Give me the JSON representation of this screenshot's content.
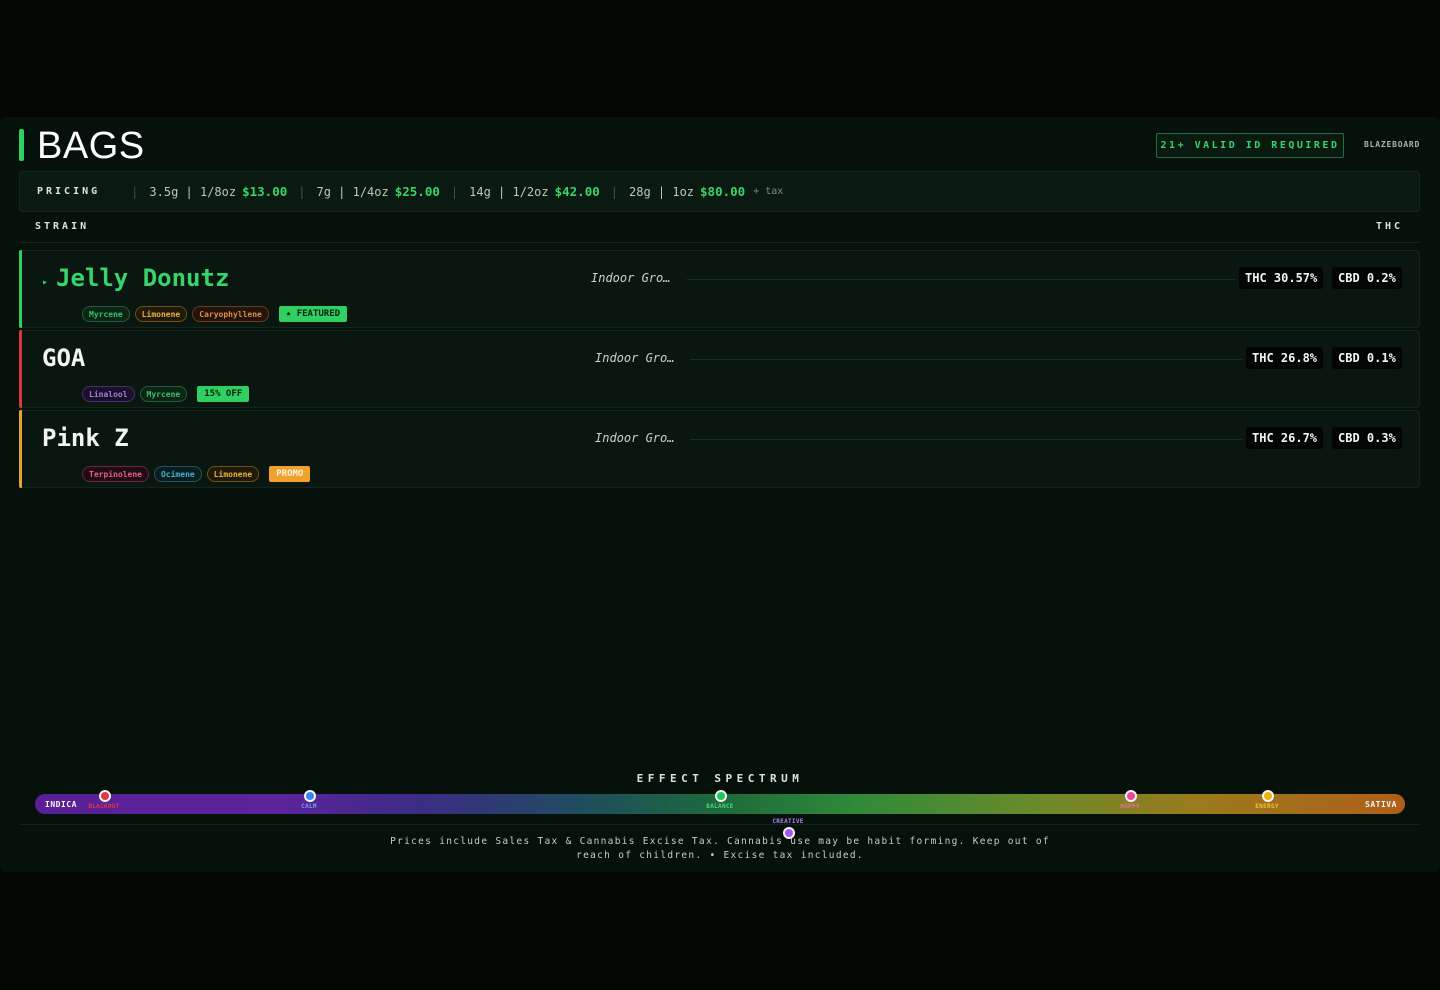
{
  "header": {
    "title": "BAGS",
    "id_badge": "21+ VALID ID REQUIRED",
    "brand": "BLAZEBOARD"
  },
  "pricing": {
    "label": "PRICING",
    "tiers": [
      {
        "size": "3.5g | 1/8oz",
        "price": "$13.00"
      },
      {
        "size": "7g | 1/4oz",
        "price": "$25.00"
      },
      {
        "size": "14g | 1/2oz",
        "price": "$42.00"
      },
      {
        "size": "28g | 1oz",
        "price": "$80.00"
      }
    ],
    "tax_note": "+ tax"
  },
  "columns": {
    "strain": "STRAIN",
    "thc": "THC"
  },
  "strains": [
    {
      "name": "Jelly Donutz",
      "featured_caret": "▸",
      "grow": "Indoor Gro…",
      "thc": "THC 30.57%",
      "cbd": "CBD 0.2%",
      "accent_color": "#2fcf62",
      "tags": [
        "Myrcene",
        "Limonene",
        "Caryophyllene"
      ],
      "badge": "★ FEATURED"
    },
    {
      "name": "GOA",
      "grow": "Indoor Gro…",
      "thc": "THC 26.8%",
      "cbd": "CBD 0.1%",
      "accent_color": "#d9383f",
      "tags": [
        "Linalool",
        "Myrcene"
      ],
      "badge": "15% OFF"
    },
    {
      "name": "Pink Z",
      "grow": "Indoor Gro…",
      "thc": "THC 26.7%",
      "cbd": "CBD 0.3%",
      "accent_color": "#e9a326",
      "tags": [
        "Terpinolene",
        "Ocimene",
        "Limonene"
      ],
      "badge": "PROMO"
    }
  ],
  "spectrum": {
    "title": "EFFECT SPECTRUM",
    "left": "INDICA",
    "right": "SATIVA",
    "markers": [
      {
        "label": "BLACKOUT",
        "color": "#e0393e"
      },
      {
        "label": "CALM",
        "color": "#3b82f6"
      },
      {
        "label": "BALANCE",
        "color": "#22c55e"
      },
      {
        "label": "CREATIVE",
        "color": "#a855f7"
      },
      {
        "label": "HAPPY",
        "color": "#ec4899"
      },
      {
        "label": "ENERGY",
        "color": "#eab308"
      }
    ]
  },
  "disclaimer": "Prices include Sales Tax & Cannabis Excise Tax. Cannabis use may be habit forming. Keep out of reach of children. • Excise tax included."
}
